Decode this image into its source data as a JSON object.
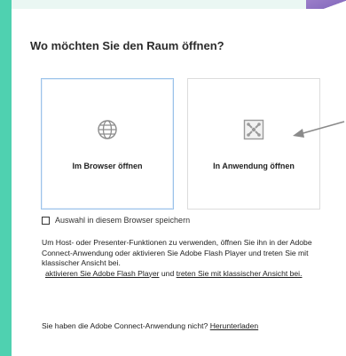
{
  "dialog": {
    "title": "Wo möchten Sie den Raum öffnen?",
    "options": [
      {
        "label": "Im Browser öffnen",
        "icon": "globe-icon",
        "selected": true
      },
      {
        "label": "In Anwendung öffnen",
        "icon": "connect-app-icon",
        "selected": false
      }
    ],
    "remember_label": "Auswahl in diesem Browser speichern",
    "remember_checked": false,
    "info_text": "Um Host- oder Presenter-Funktionen zu verwenden, öffnen Sie ihn in der Adobe Connect-Anwendung oder aktivieren Sie Adobe Flash Player und treten Sie mit klassischer Ansicht bei.",
    "link_flash": "aktivieren Sie Adobe Flash Player",
    "link_conjunction": "und",
    "link_classic": "treten Sie mit klassischer Ansicht bei.",
    "help_text": "Sie haben die Adobe Connect-Anwendung nicht?",
    "help_link": "Herunterladen"
  },
  "colors": {
    "accent": "#4fd1b0",
    "selected_border": "#9cc3ea",
    "arrow": "#8a8a8a"
  }
}
